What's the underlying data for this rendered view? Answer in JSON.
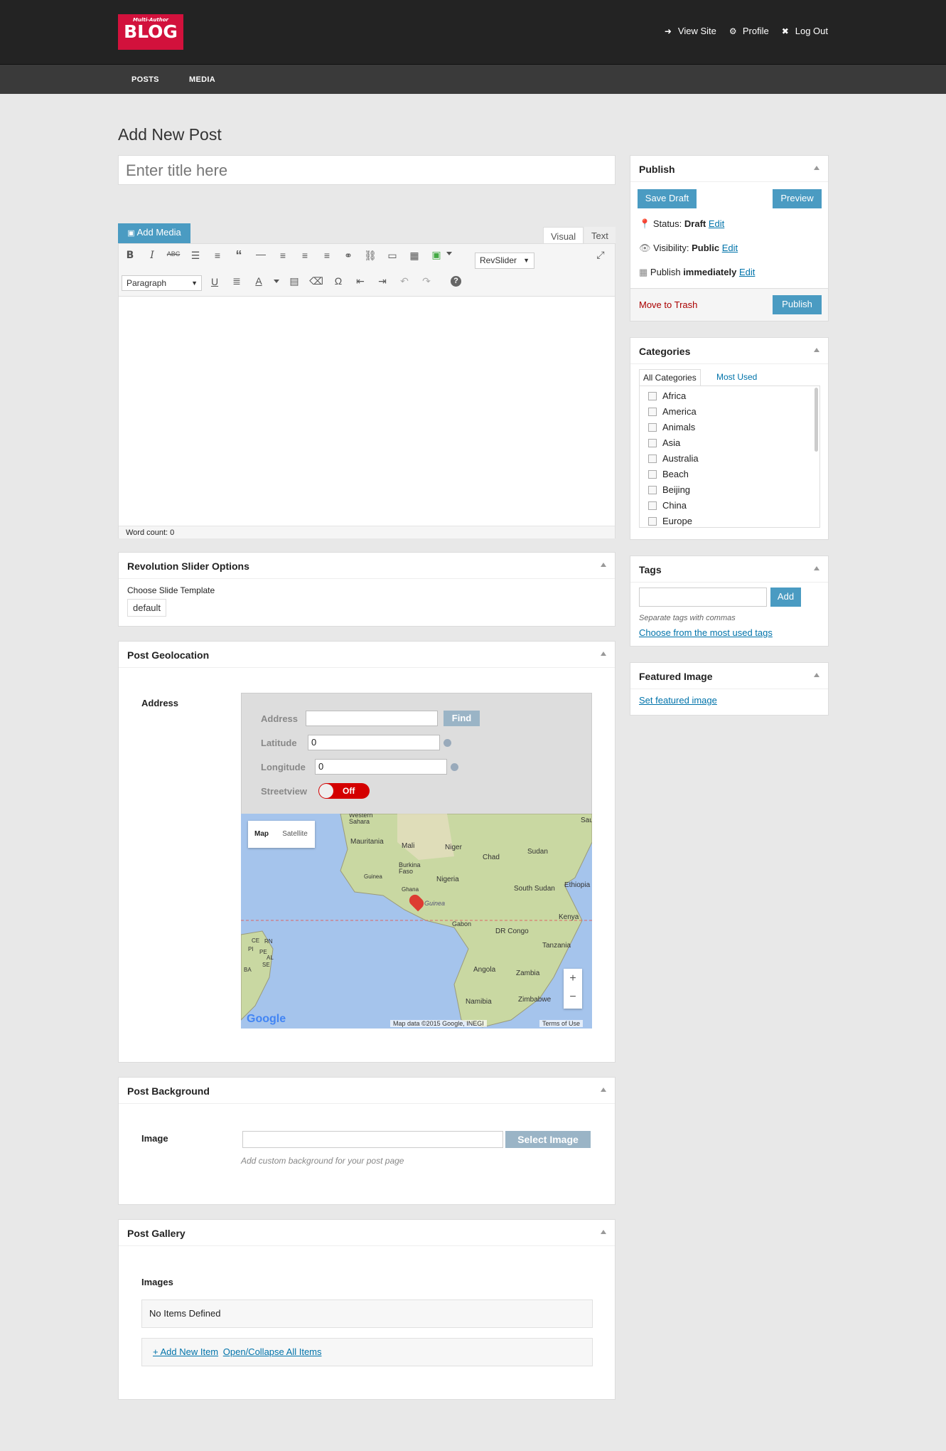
{
  "brand": {
    "logo_small": "Multi-Author",
    "logo_big": "BLOG"
  },
  "toplinks": {
    "view_site": "View Site",
    "profile": "Profile",
    "logout": "Log Out"
  },
  "nav": {
    "posts": "POSTS",
    "media": "MEDIA"
  },
  "page": {
    "title": "Add New Post",
    "title_placeholder": "Enter title here"
  },
  "editor": {
    "add_media": "Add Media",
    "tab_visual": "Visual",
    "tab_text": "Text",
    "revslider": "RevSlider",
    "format": "Paragraph",
    "word_count": "Word count: 0"
  },
  "revslider_box": {
    "title": "Revolution Slider Options",
    "choose": "Choose Slide Template",
    "value": "default"
  },
  "geo": {
    "title": "Post Geolocation",
    "address_label": "Address",
    "f_address": "Address",
    "find": "Find",
    "f_lat": "Latitude",
    "lat": "0",
    "f_lng": "Longitude",
    "lng": "0",
    "f_street": "Streetview",
    "street": "Off",
    "map_btn": "Map",
    "sat_btn": "Satellite",
    "places": [
      "Western Sahara",
      "Mauritania",
      "Mali",
      "Niger",
      "Chad",
      "Sudan",
      "Burkina Faso",
      "Guinea",
      "Ghana",
      "Nigeria",
      "Ethiopia",
      "South Sudan",
      "of Guinea",
      "Gabon",
      "DR Congo",
      "Kenya",
      "Tanzania",
      "Angola",
      "Zambia",
      "Namibia",
      "Zimbabwe",
      "CE",
      "RN",
      "PI",
      "PE",
      "AL",
      "SE",
      "BA",
      "Sau"
    ],
    "attrib": "Map data ©2015 Google, INEGI",
    "terms": "Terms of Use",
    "google": "Google"
  },
  "background": {
    "title": "Post Background",
    "label": "Image",
    "select": "Select Image",
    "hint": "Add custom background for your post page"
  },
  "gallery": {
    "title": "Post Gallery",
    "label": "Images",
    "empty": "No Items Defined",
    "add": "+ Add New Item",
    "toggle": "Open/Collapse All Items"
  },
  "publish": {
    "title": "Publish",
    "save_draft": "Save Draft",
    "preview": "Preview",
    "status_label": "Status:",
    "status": "Draft",
    "visibility_label": "Visibility:",
    "visibility": "Public",
    "publish_label": "Publish",
    "publish_when": "immediately",
    "edit": "Edit",
    "trash": "Move to Trash",
    "publish_btn": "Publish"
  },
  "categories": {
    "title": "Categories",
    "tab_all": "All Categories",
    "tab_used": "Most Used",
    "items": [
      "Africa",
      "America",
      "Animals",
      "Asia",
      "Australia",
      "Beach",
      "Beijing",
      "China",
      "Europe"
    ]
  },
  "tags": {
    "title": "Tags",
    "add": "Add",
    "hint": "Separate tags with commas",
    "choose": "Choose from the most used tags"
  },
  "featured": {
    "title": "Featured Image",
    "link": "Set featured image"
  }
}
